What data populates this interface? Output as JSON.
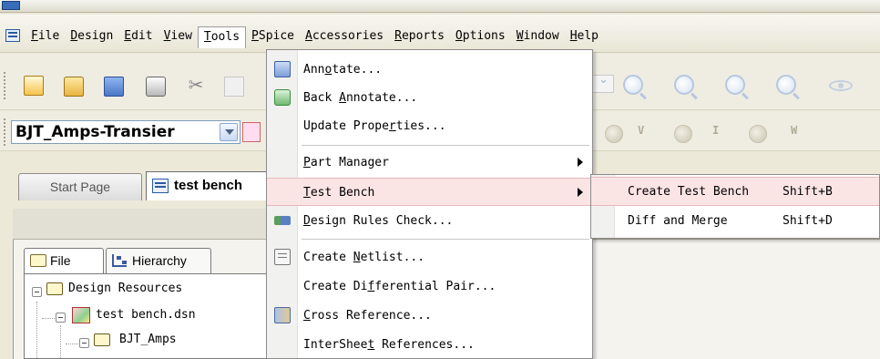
{
  "menubar": {
    "items": [
      {
        "mnemonic": "F",
        "rest": "ile"
      },
      {
        "mnemonic": "D",
        "rest": "esign"
      },
      {
        "mnemonic": "E",
        "rest": "dit"
      },
      {
        "mnemonic": "V",
        "rest": "iew"
      },
      {
        "mnemonic": "T",
        "rest": "ools"
      },
      {
        "mnemonic": "P",
        "rest": "Spice"
      },
      {
        "mnemonic": "A",
        "rest": "ccessories"
      },
      {
        "mnemonic": "R",
        "rest": "eports"
      },
      {
        "mnemonic": "O",
        "rest": "ptions"
      },
      {
        "mnemonic": "W",
        "rest": "indow"
      },
      {
        "mnemonic": "H",
        "rest": "elp"
      }
    ]
  },
  "toolbar2": {
    "design_combo_value": "BJT_Amps-Transier",
    "probe_labels": [
      "V",
      "I",
      "W"
    ]
  },
  "tabs": {
    "start_page": "Start Page",
    "test_bench": "test bench"
  },
  "project_panel": {
    "file_tab": "File",
    "hierarchy_tab": "Hierarchy"
  },
  "tree": {
    "root": "Design Resources",
    "dsn": "test bench.dsn",
    "folder": "BJT_Amps"
  },
  "tools_menu": {
    "annotate": {
      "pre": "Ann",
      "ul": "o",
      "post": "tate..."
    },
    "back_annotate": {
      "pre": "Back ",
      "ul": "A",
      "post": "nnotate..."
    },
    "update_properties": {
      "pre": "Update Prope",
      "ul": "r",
      "post": "ties..."
    },
    "part_manager": {
      "pre": "",
      "ul": "P",
      "post": "art Manager"
    },
    "test_bench": {
      "pre": "",
      "ul": "T",
      "post": "est Bench"
    },
    "design_rules_check": {
      "pre": "",
      "ul": "D",
      "post": "esign Rules Check..."
    },
    "create_netlist": {
      "pre": "Create ",
      "ul": "N",
      "post": "etlist..."
    },
    "create_differential_pair": {
      "pre": "Create Di",
      "ul": "f",
      "post": "ferential Pair..."
    },
    "cross_reference": {
      "pre": "",
      "ul": "C",
      "post": "ross Reference..."
    },
    "intersheet_references": {
      "pre": "InterShee",
      "ul": "t",
      "post": " References..."
    }
  },
  "test_bench_submenu": {
    "items": [
      {
        "label": "Create Test Bench",
        "shortcut": "Shift+B"
      },
      {
        "label": "Diff and Merge",
        "shortcut": "Shift+D"
      }
    ]
  },
  "colors": {
    "highlight": "#fbe4e4",
    "menubar_bg": "#efede2"
  }
}
